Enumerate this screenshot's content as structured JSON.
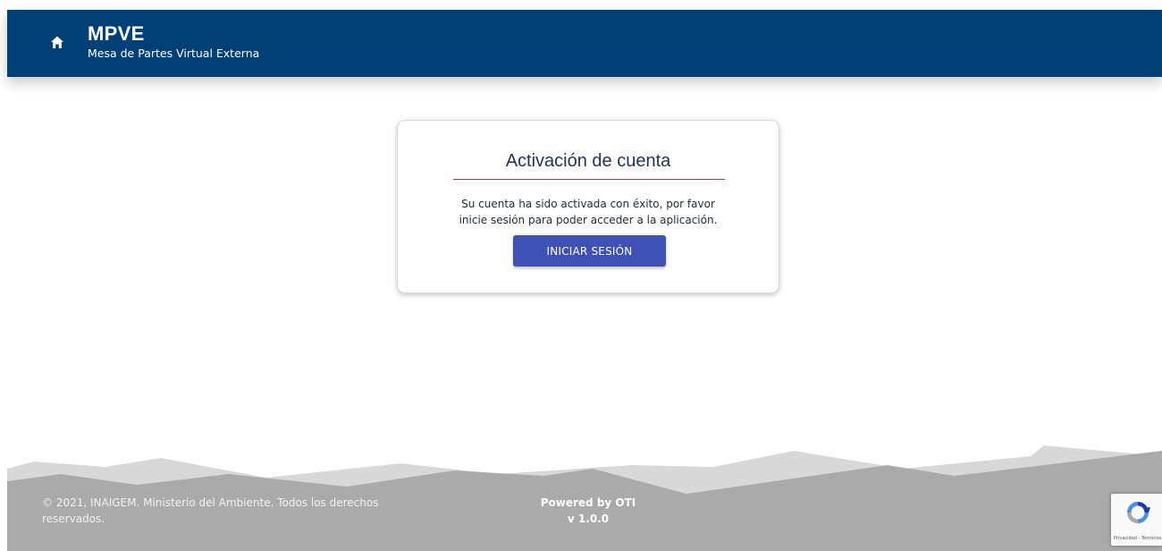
{
  "header": {
    "title": "MPVE",
    "subtitle": "Mesa de Partes Virtual Externa",
    "home_icon": "home-icon",
    "background": "#004077"
  },
  "card": {
    "title": "Activación de cuenta",
    "message_line1": "Su cuenta ha sido activada con éxito, por favor",
    "message_line2": "inicie sesión para poder acceder a la aplicación.",
    "login_button_label": "INICIAR SESIÓN",
    "divider_color": "#b8323c",
    "button_color": "#3f51b5"
  },
  "footer": {
    "copyright_line1": "© 2021, INAIGEM. Ministerio del Ambiente. Todos los derechos",
    "copyright_line2": "reservados.",
    "powered_by": "Powered by OTI",
    "version": "v 1.0.0"
  },
  "recaptcha": {
    "icon": "recaptcha-icon",
    "links": "Privacidad - Términos"
  }
}
